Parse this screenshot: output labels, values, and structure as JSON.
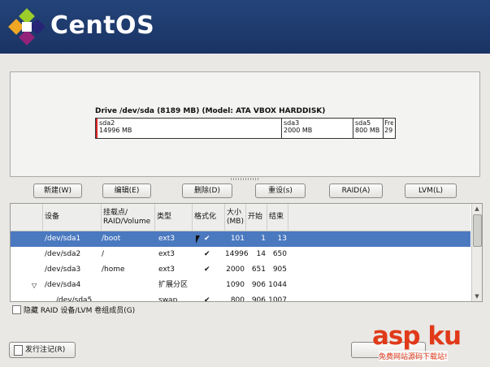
{
  "header": {
    "brand": "CentOS"
  },
  "drive": {
    "title": "Drive /dev/sda (8189 MB) (Model: ATA VBOX HARDDISK)",
    "segments": [
      {
        "name": "sda2",
        "size": "14996 MB"
      },
      {
        "name": "sda3",
        "size": "2000 MB"
      },
      {
        "name": "sda5",
        "size": "800 MB"
      },
      {
        "name": "Fre",
        "size": "29"
      }
    ]
  },
  "buttons": {
    "new": "新建(W)",
    "edit": "编辑(E)",
    "delete": "删除(D)",
    "reset": "重设(s)",
    "raid": "RAID(A)",
    "lvm": "LVM(L)"
  },
  "table": {
    "headers": {
      "device": "设备",
      "mount": "挂载点/\nRAID/Volume",
      "type": "类型",
      "format": "格式化",
      "size": "大小\n(MB)",
      "start": "开始",
      "end": "结束"
    },
    "rows": [
      {
        "device": "/dev/sda1",
        "mount": "/boot",
        "type": "ext3",
        "format": "✔",
        "size": "101",
        "start": "1",
        "end": "13"
      },
      {
        "device": "/dev/sda2",
        "mount": "/",
        "type": "ext3",
        "format": "✔",
        "size": "14996",
        "start": "14",
        "end": "650"
      },
      {
        "device": "/dev/sda3",
        "mount": "/home",
        "type": "ext3",
        "format": "✔",
        "size": "2000",
        "start": "651",
        "end": "905"
      },
      {
        "device": "/dev/sda4",
        "mount": "",
        "type": "扩展分区",
        "format": "",
        "size": "1090",
        "start": "906",
        "end": "1044"
      },
      {
        "device": "/dev/sda5",
        "mount": "",
        "type": "swap",
        "format": "✔",
        "size": "800",
        "start": "906",
        "end": "1007"
      }
    ]
  },
  "options": {
    "hide_raid_label": "隐藏 RAID 设备/LVM 卷组成员(G)"
  },
  "footer": {
    "release_notes": "发行注记(R)"
  },
  "watermark": {
    "main": "asp ku",
    "sub": "免费网站源码下载站!"
  },
  "colors": {
    "header": "#1f3b6f",
    "selection": "#4b79c0",
    "watermark": "#e03a1a"
  }
}
